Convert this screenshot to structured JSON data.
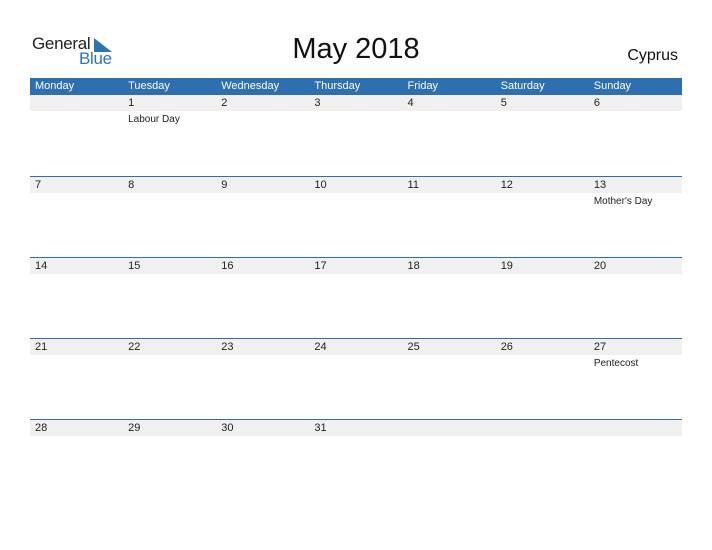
{
  "logo": {
    "general": "General",
    "blue": "Blue"
  },
  "title": "May 2018",
  "country": "Cyprus",
  "weekdays": [
    "Monday",
    "Tuesday",
    "Wednesday",
    "Thursday",
    "Friday",
    "Saturday",
    "Sunday"
  ],
  "weeks": [
    [
      {
        "day": "",
        "holiday": ""
      },
      {
        "day": "1",
        "holiday": "Labour Day"
      },
      {
        "day": "2",
        "holiday": ""
      },
      {
        "day": "3",
        "holiday": ""
      },
      {
        "day": "4",
        "holiday": ""
      },
      {
        "day": "5",
        "holiday": ""
      },
      {
        "day": "6",
        "holiday": ""
      }
    ],
    [
      {
        "day": "7",
        "holiday": ""
      },
      {
        "day": "8",
        "holiday": ""
      },
      {
        "day": "9",
        "holiday": ""
      },
      {
        "day": "10",
        "holiday": ""
      },
      {
        "day": "11",
        "holiday": ""
      },
      {
        "day": "12",
        "holiday": ""
      },
      {
        "day": "13",
        "holiday": "Mother's Day"
      }
    ],
    [
      {
        "day": "14",
        "holiday": ""
      },
      {
        "day": "15",
        "holiday": ""
      },
      {
        "day": "16",
        "holiday": ""
      },
      {
        "day": "17",
        "holiday": ""
      },
      {
        "day": "18",
        "holiday": ""
      },
      {
        "day": "19",
        "holiday": ""
      },
      {
        "day": "20",
        "holiday": ""
      }
    ],
    [
      {
        "day": "21",
        "holiday": ""
      },
      {
        "day": "22",
        "holiday": ""
      },
      {
        "day": "23",
        "holiday": ""
      },
      {
        "day": "24",
        "holiday": ""
      },
      {
        "day": "25",
        "holiday": ""
      },
      {
        "day": "26",
        "holiday": ""
      },
      {
        "day": "27",
        "holiday": "Pentecost"
      }
    ],
    [
      {
        "day": "28",
        "holiday": ""
      },
      {
        "day": "29",
        "holiday": ""
      },
      {
        "day": "30",
        "holiday": ""
      },
      {
        "day": "31",
        "holiday": ""
      },
      {
        "day": "",
        "holiday": ""
      },
      {
        "day": "",
        "holiday": ""
      },
      {
        "day": "",
        "holiday": ""
      }
    ]
  ],
  "colors": {
    "accent": "#2e6fb0",
    "row_band": "#f0f0f0"
  }
}
